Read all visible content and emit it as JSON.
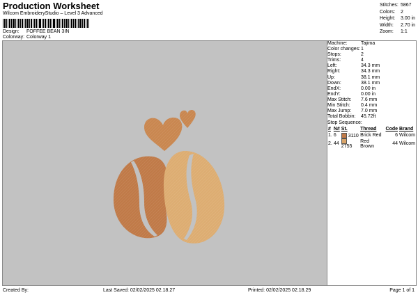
{
  "header": {
    "title": "Production Worksheet",
    "subtitle": "Wilcom EmbroideryStudio – Level 3 Advanced",
    "design_label": "Design:",
    "design_value": "FOFFEE BEAN 3IN",
    "colorway_label": "Colorway:",
    "colorway_value": "Colorway 1"
  },
  "top_stats": [
    {
      "label": "Stitches:",
      "value": "5867"
    },
    {
      "label": "Colors:",
      "value": "2"
    },
    {
      "label": "Height:",
      "value": "3.00 in"
    },
    {
      "label": "Width:",
      "value": "2.70 in"
    },
    {
      "label": "Zoom:",
      "value": "1:1"
    }
  ],
  "specs": [
    {
      "label": "Machine:",
      "value": "Tajima"
    },
    {
      "label": "Color changes:",
      "value": "1"
    },
    {
      "label": "Stops:",
      "value": "2"
    },
    {
      "label": "Trims:",
      "value": "4"
    },
    {
      "label": "Left:",
      "value": "34.3 mm"
    },
    {
      "label": "Right:",
      "value": "34.3 mm"
    },
    {
      "label": "Up:",
      "value": "38.1 mm"
    },
    {
      "label": "Down:",
      "value": "38.1 mm"
    },
    {
      "label": "EndX:",
      "value": "0.00 in"
    },
    {
      "label": "EndY:",
      "value": "0.00 in"
    },
    {
      "label": "Max Stitch:",
      "value": "7.6 mm"
    },
    {
      "label": "Min Stitch:",
      "value": "0.4 mm"
    },
    {
      "label": "Max Jump:",
      "value": "7.0 mm"
    },
    {
      "label": "Total Bobbin:",
      "value": "45.72ft"
    }
  ],
  "stop_sequence": {
    "title": "Stop Sequence:",
    "headers": [
      "#",
      "N#",
      "St.",
      "Thread",
      "Code",
      "Brand"
    ],
    "rows": [
      {
        "num": "1.",
        "needle": "6",
        "code_st": "3110",
        "name": "Brick Red",
        "code": "6",
        "brand": "Wilcom",
        "color": "#c07a48"
      },
      {
        "num": "2.",
        "needle": "44",
        "code_st": "2755",
        "name": "Red Brown",
        "code": "44",
        "brand": "Wilcom",
        "color": "#d9a468"
      }
    ]
  },
  "footer": {
    "created": "Created By:",
    "last_saved": "Last Saved: 02/02/2025 02.18.27",
    "printed": "Printed: 02/02/2025 02.18.29",
    "page": "Page 1 of 1"
  },
  "colors": {
    "canvas": "#c2c2c2",
    "bean_dark": "#c07a48",
    "bean_light": "#ddad72",
    "heart": "#c98750"
  }
}
